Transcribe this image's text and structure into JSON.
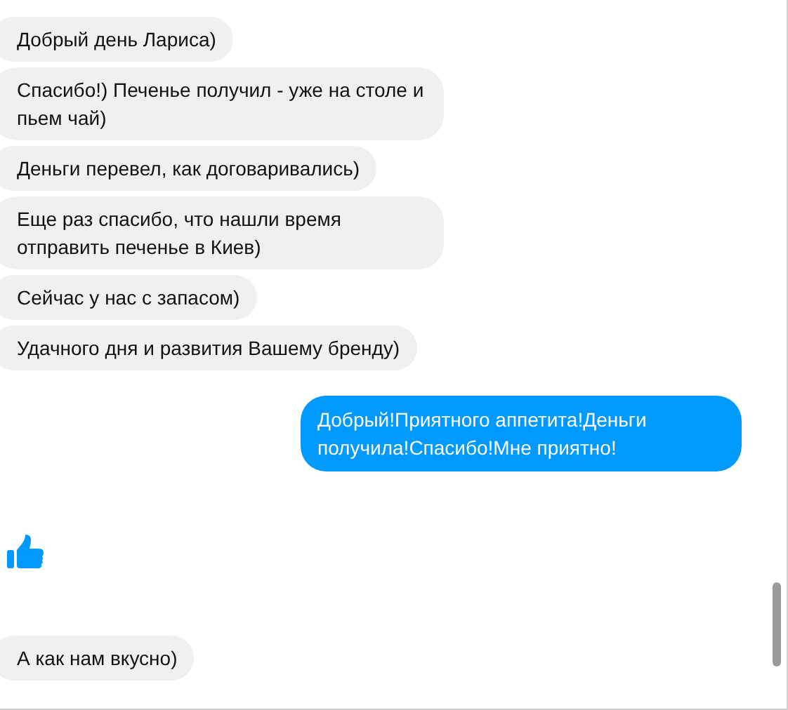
{
  "messages": [
    {
      "kind": "incoming",
      "text": "Добрый день Лариса)"
    },
    {
      "kind": "incoming",
      "text": "Спасибо!) Печенье получил - уже на столе и пьем чай)"
    },
    {
      "kind": "incoming",
      "text": "Деньги перевел, как договаривались)"
    },
    {
      "kind": "incoming",
      "text": "Еще раз спасибо, что нашли время отправить печенье в Киев)"
    },
    {
      "kind": "incoming",
      "text": "Сейчас у нас с запасом)"
    },
    {
      "kind": "incoming",
      "text": "Удачного дня и развития Вашему бренду)"
    },
    {
      "kind": "outgoing",
      "text": "Добрый!Приятного аппетита!Деньги получила!Спасибо!Мне приятно!"
    },
    {
      "kind": "like"
    },
    {
      "kind": "incoming",
      "text": "А как нам вкусно)"
    }
  ]
}
